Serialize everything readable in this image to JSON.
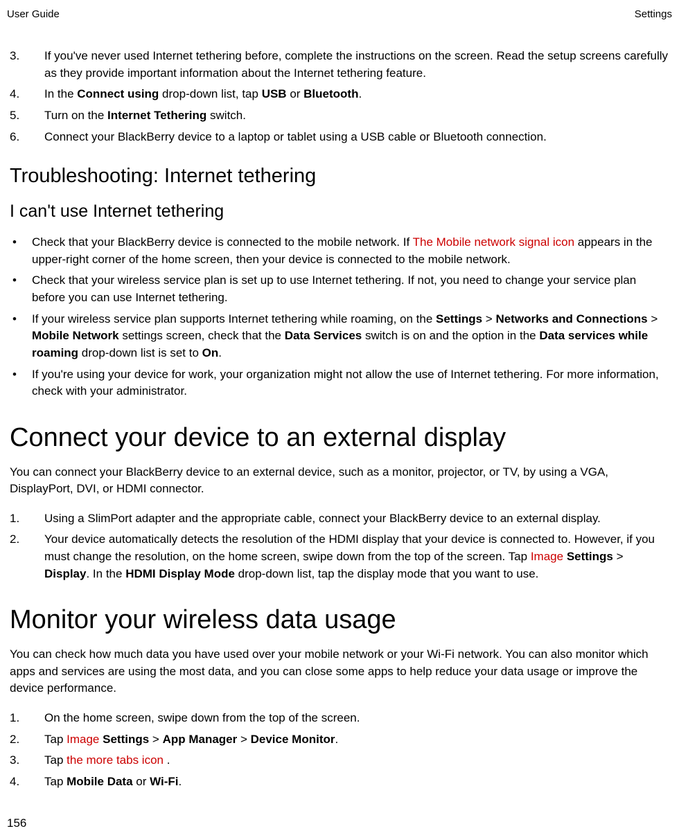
{
  "header": {
    "left": "User Guide",
    "right": "Settings"
  },
  "steps_a": {
    "s3": {
      "num": "3.",
      "text": "If you've never used Internet tethering before, complete the instructions on the screen. Read the setup screens carefully as they provide important information about the Internet tethering feature."
    },
    "s4": {
      "num": "4.",
      "pre": "In the ",
      "b1": "Connect using",
      "mid": " drop-down list, tap ",
      "b2": "USB",
      "or": " or ",
      "b3": "Bluetooth",
      "end": "."
    },
    "s5": {
      "num": "5.",
      "pre": "Turn on the ",
      "b1": "Internet Tethering",
      "end": " switch."
    },
    "s6": {
      "num": "6.",
      "text": "Connect your BlackBerry device to a laptop or tablet using a USB cable or Bluetooth connection."
    }
  },
  "ts": {
    "title": "Troubleshooting: Internet tethering",
    "subtitle": "I can't use Internet tethering"
  },
  "bullets": {
    "b1": {
      "pre": "Check that your BlackBerry device is connected to the mobile network. If  ",
      "red": "The Mobile network signal icon",
      "post": "  appears in the upper-right corner of the home screen, then your device is connected to the mobile network."
    },
    "b2": {
      "text": "Check that your wireless service plan is set up to use Internet tethering. If not, you need to change your service plan before you can use Internet tethering."
    },
    "b3": {
      "p1": "If your wireless service plan supports Internet tethering while roaming, on the ",
      "bb1": "Settings",
      "gt1": " > ",
      "bb2": "Networks and Connections",
      "gt2": " > ",
      "bb3": "Mobile Network",
      "p2": " settings screen, check that the ",
      "bb4": "Data Services",
      "p3": " switch is on and the option in the ",
      "bb5": "Data services while roaming",
      "p4": " drop-down list is set to ",
      "bb6": "On",
      "p5": "."
    },
    "b4": {
      "text": "If you're using your device for work, your organization might not allow the use of Internet tethering. For more information, check with your administrator."
    }
  },
  "ext": {
    "title": "Connect your device to an external display",
    "intro": "You can connect your BlackBerry device to an external device, such as a monitor, projector, or TV, by using a VGA, DisplayPort, DVI, or HDMI connector.",
    "s1": {
      "num": "1.",
      "text": "Using a SlimPort adapter and the appropriate cable, connect your BlackBerry device to an external display."
    },
    "s2": {
      "num": "2.",
      "p1": "Your device automatically detects the resolution of the HDMI display that your device is connected to. However, if you must change the resolution, on the home screen, swipe down from the top of the screen. Tap  ",
      "red": "Image",
      "sp": "  ",
      "bb1": "Settings",
      "gt": " > ",
      "bb2": "Display",
      "p2": ". In the ",
      "bb3": "HDMI Display Mode",
      "p3": " drop-down list, tap the display mode that you want to use."
    }
  },
  "mon": {
    "title": "Monitor your wireless data usage",
    "intro": "You can check how much data you have used over your mobile network or your Wi-Fi network. You can also monitor which apps and services are using the most data, and you can close some apps to help reduce your data usage or improve the device performance.",
    "s1": {
      "num": "1.",
      "text": "On the home screen, swipe down from the top of the screen."
    },
    "s2": {
      "num": "2.",
      "p1": "Tap  ",
      "red": "Image",
      "sp": "  ",
      "bb1": "Settings",
      "gt1": " > ",
      "bb2": "App Manager",
      "gt2": " > ",
      "bb3": "Device Monitor",
      "end": "."
    },
    "s3": {
      "num": "3.",
      "p1": "Tap  ",
      "red": "the more tabs icon",
      "end": " ."
    },
    "s4": {
      "num": "4.",
      "p1": "Tap ",
      "bb1": "Mobile Data",
      "or": " or ",
      "bb2": "Wi-Fi",
      "end": "."
    }
  },
  "page": "156"
}
